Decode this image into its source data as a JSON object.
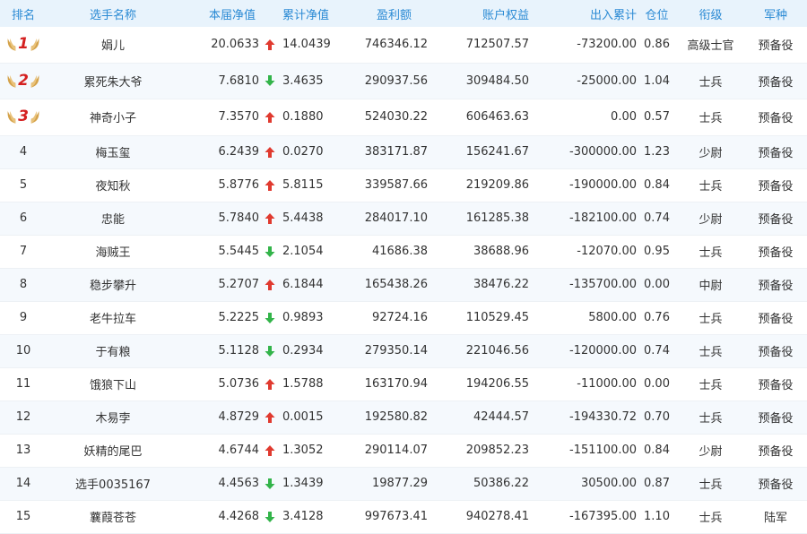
{
  "header": {
    "rank": "排名",
    "name": "选手名称",
    "net": "本届净值",
    "cum": "累计净值",
    "profit": "盈利额",
    "equity": "账户权益",
    "flow": "出入累计",
    "pos": "仓位",
    "title": "衔级",
    "arm": "军种"
  },
  "colors": {
    "up": "#e03a2f",
    "down": "#33b44a",
    "header_text": "#2a8ad4",
    "header_bg": "#e8f3fc"
  },
  "rows": [
    {
      "rank": "1",
      "name": "娟儿",
      "net": "20.0633",
      "dir": "up",
      "cum": "14.0439",
      "profit": "746346.12",
      "equity": "712507.57",
      "flow": "-73200.00",
      "pos": "0.86",
      "title": "高级士官",
      "arm": "预备役"
    },
    {
      "rank": "2",
      "name": "累死朱大爷",
      "net": "7.6810",
      "dir": "down",
      "cum": "3.4635",
      "profit": "290937.56",
      "equity": "309484.50",
      "flow": "-25000.00",
      "pos": "1.04",
      "title": "士兵",
      "arm": "预备役"
    },
    {
      "rank": "3",
      "name": "神奇小子",
      "net": "7.3570",
      "dir": "up",
      "cum": "0.1880",
      "profit": "524030.22",
      "equity": "606463.63",
      "flow": "0.00",
      "pos": "0.57",
      "title": "士兵",
      "arm": "预备役"
    },
    {
      "rank": "4",
      "name": "梅玉玺",
      "net": "6.2439",
      "dir": "up",
      "cum": "0.0270",
      "profit": "383171.87",
      "equity": "156241.67",
      "flow": "-300000.00",
      "pos": "1.23",
      "title": "少尉",
      "arm": "预备役"
    },
    {
      "rank": "5",
      "name": "夜知秋",
      "net": "5.8776",
      "dir": "up",
      "cum": "5.8115",
      "profit": "339587.66",
      "equity": "219209.86",
      "flow": "-190000.00",
      "pos": "0.84",
      "title": "士兵",
      "arm": "预备役"
    },
    {
      "rank": "6",
      "name": "忠能",
      "net": "5.7840",
      "dir": "up",
      "cum": "5.4438",
      "profit": "284017.10",
      "equity": "161285.38",
      "flow": "-182100.00",
      "pos": "0.74",
      "title": "少尉",
      "arm": "预备役"
    },
    {
      "rank": "7",
      "name": "海贼王",
      "net": "5.5445",
      "dir": "down",
      "cum": "2.1054",
      "profit": "41686.38",
      "equity": "38688.96",
      "flow": "-12070.00",
      "pos": "0.95",
      "title": "士兵",
      "arm": "预备役"
    },
    {
      "rank": "8",
      "name": "稳步攀升",
      "net": "5.2707",
      "dir": "up",
      "cum": "6.1844",
      "profit": "165438.26",
      "equity": "38476.22",
      "flow": "-135700.00",
      "pos": "0.00",
      "title": "中尉",
      "arm": "预备役"
    },
    {
      "rank": "9",
      "name": "老牛拉车",
      "net": "5.2225",
      "dir": "down",
      "cum": "0.9893",
      "profit": "92724.16",
      "equity": "110529.45",
      "flow": "5800.00",
      "pos": "0.76",
      "title": "士兵",
      "arm": "预备役"
    },
    {
      "rank": "10",
      "name": "于有粮",
      "net": "5.1128",
      "dir": "down",
      "cum": "0.2934",
      "profit": "279350.14",
      "equity": "221046.56",
      "flow": "-120000.00",
      "pos": "0.74",
      "title": "士兵",
      "arm": "预备役"
    },
    {
      "rank": "11",
      "name": "饿狼下山",
      "net": "5.0736",
      "dir": "up",
      "cum": "1.5788",
      "profit": "163170.94",
      "equity": "194206.55",
      "flow": "-11000.00",
      "pos": "0.00",
      "title": "士兵",
      "arm": "预备役"
    },
    {
      "rank": "12",
      "name": "木易孛",
      "net": "4.8729",
      "dir": "up",
      "cum": "0.0015",
      "profit": "192580.82",
      "equity": "42444.57",
      "flow": "-194330.72",
      "pos": "0.70",
      "title": "士兵",
      "arm": "预备役"
    },
    {
      "rank": "13",
      "name": "妖精的尾巴",
      "net": "4.6744",
      "dir": "up",
      "cum": "1.3052",
      "profit": "290114.07",
      "equity": "209852.23",
      "flow": "-151100.00",
      "pos": "0.84",
      "title": "少尉",
      "arm": "预备役"
    },
    {
      "rank": "14",
      "name": "选手0035167",
      "net": "4.4563",
      "dir": "down",
      "cum": "1.3439",
      "profit": "19877.29",
      "equity": "50386.22",
      "flow": "30500.00",
      "pos": "0.87",
      "title": "士兵",
      "arm": "预备役"
    },
    {
      "rank": "15",
      "name": "蘘葭苍苍",
      "net": "4.4268",
      "dir": "down",
      "cum": "3.4128",
      "profit": "997673.41",
      "equity": "940278.41",
      "flow": "-167395.00",
      "pos": "1.10",
      "title": "士兵",
      "arm": "陆军"
    }
  ]
}
